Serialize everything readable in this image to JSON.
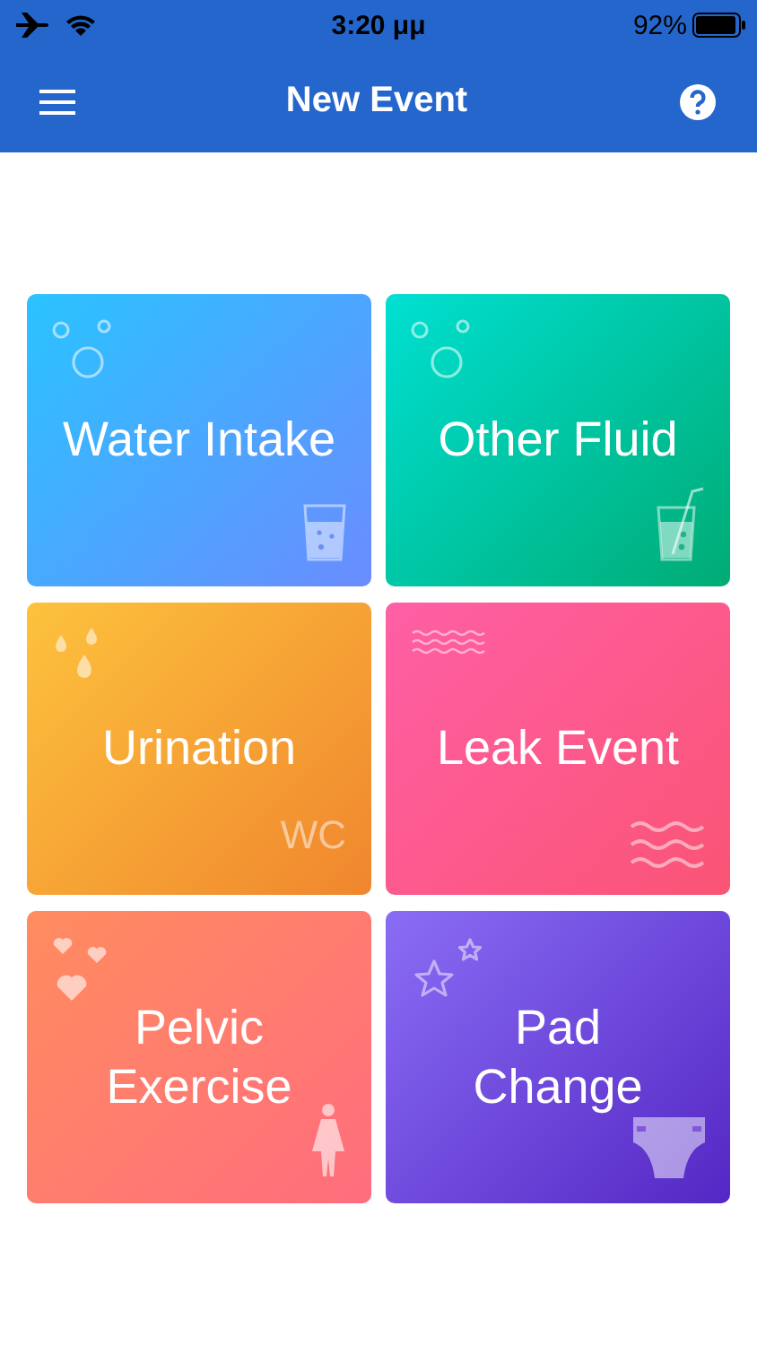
{
  "status_bar": {
    "time": "3:20 μμ",
    "battery_text": "92%"
  },
  "nav_bar": {
    "title": "New Event"
  },
  "tiles": [
    {
      "label": "Water Intake",
      "kind": "water"
    },
    {
      "label": "Other Fluid",
      "kind": "fluid"
    },
    {
      "label": "Urination",
      "kind": "urination",
      "corner_text": "WC"
    },
    {
      "label": "Leak Event",
      "kind": "leak"
    },
    {
      "label": "Pelvic Exercise",
      "kind": "pelvic"
    },
    {
      "label": "Pad Change",
      "kind": "pad"
    }
  ]
}
